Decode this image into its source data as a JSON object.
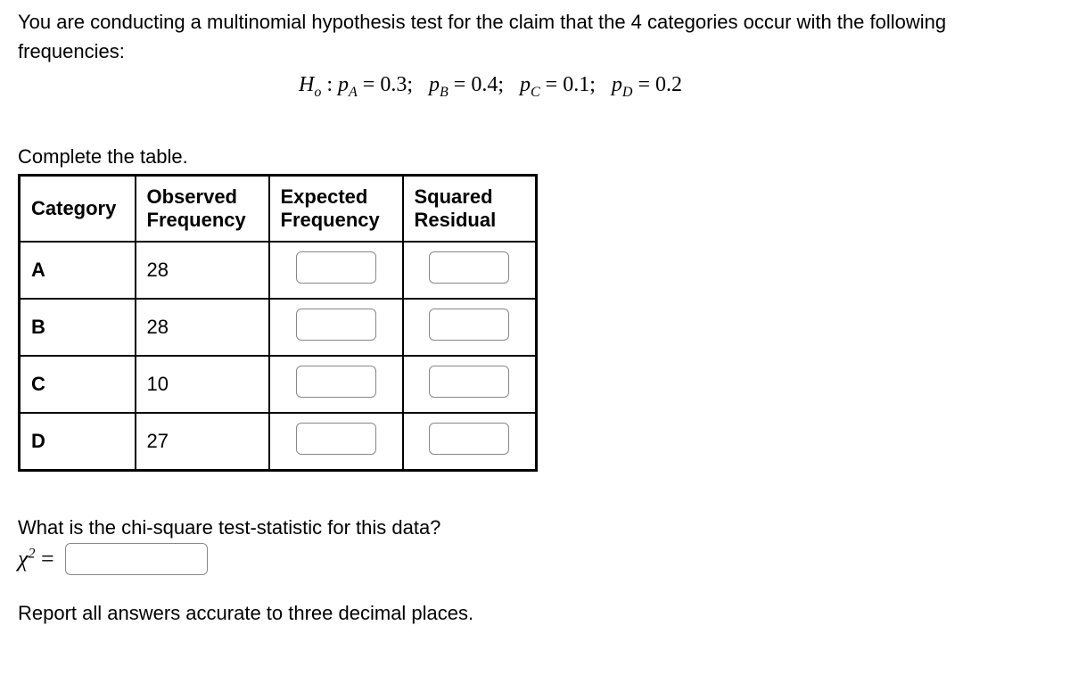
{
  "intro": "You are conducting a multinomial hypothesis test for the claim that the 4 categories occur with the following frequencies:",
  "hypothesis": {
    "h_label": "H",
    "h_sub": "o",
    "pA_label": "p",
    "pA_sub": "A",
    "pA_val": "0.3",
    "pB_label": "p",
    "pB_sub": "B",
    "pB_val": "0.4",
    "pC_label": "p",
    "pC_sub": "C",
    "pC_val": "0.1",
    "pD_label": "p",
    "pD_sub": "D",
    "pD_val": "0.2"
  },
  "complete_label": "Complete the table.",
  "table": {
    "headers": {
      "category": "Category",
      "observed": "Observed Frequency",
      "expected": "Expected Frequency",
      "residual": "Squared Residual"
    },
    "rows": [
      {
        "category": "A",
        "observed": "28"
      },
      {
        "category": "B",
        "observed": "28"
      },
      {
        "category": "C",
        "observed": "10"
      },
      {
        "category": "D",
        "observed": "27"
      }
    ]
  },
  "chi_question": "What is the chi-square test-statistic for this data?",
  "chi_symbol": "χ",
  "chi_sup": "2",
  "equals": "=",
  "report": "Report all answers accurate to three decimal places."
}
